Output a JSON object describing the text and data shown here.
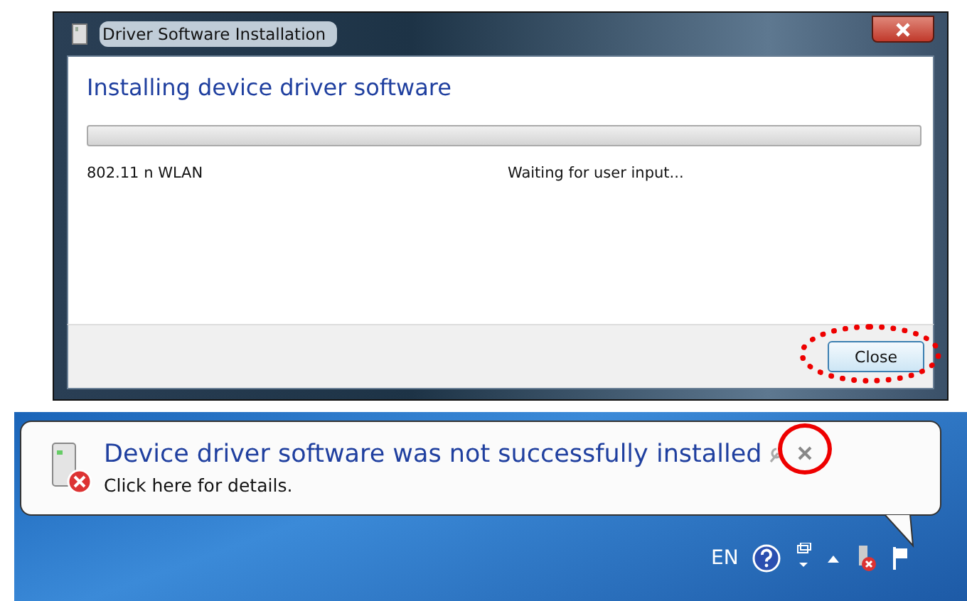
{
  "dialog": {
    "title": "Driver Software Installation",
    "heading": "Installing device driver software",
    "progress": {
      "level": 0
    },
    "devices": [
      {
        "name": "802.11 n WLAN",
        "status": "Waiting for user input..."
      }
    ],
    "buttons": [
      {
        "label": "Close",
        "highlighted": true
      }
    ]
  },
  "notification": {
    "title": "Device driver software was not successfully installed",
    "link": "Click here for details.",
    "close_highlighted": true
  },
  "taskbar": {
    "language": "EN"
  }
}
